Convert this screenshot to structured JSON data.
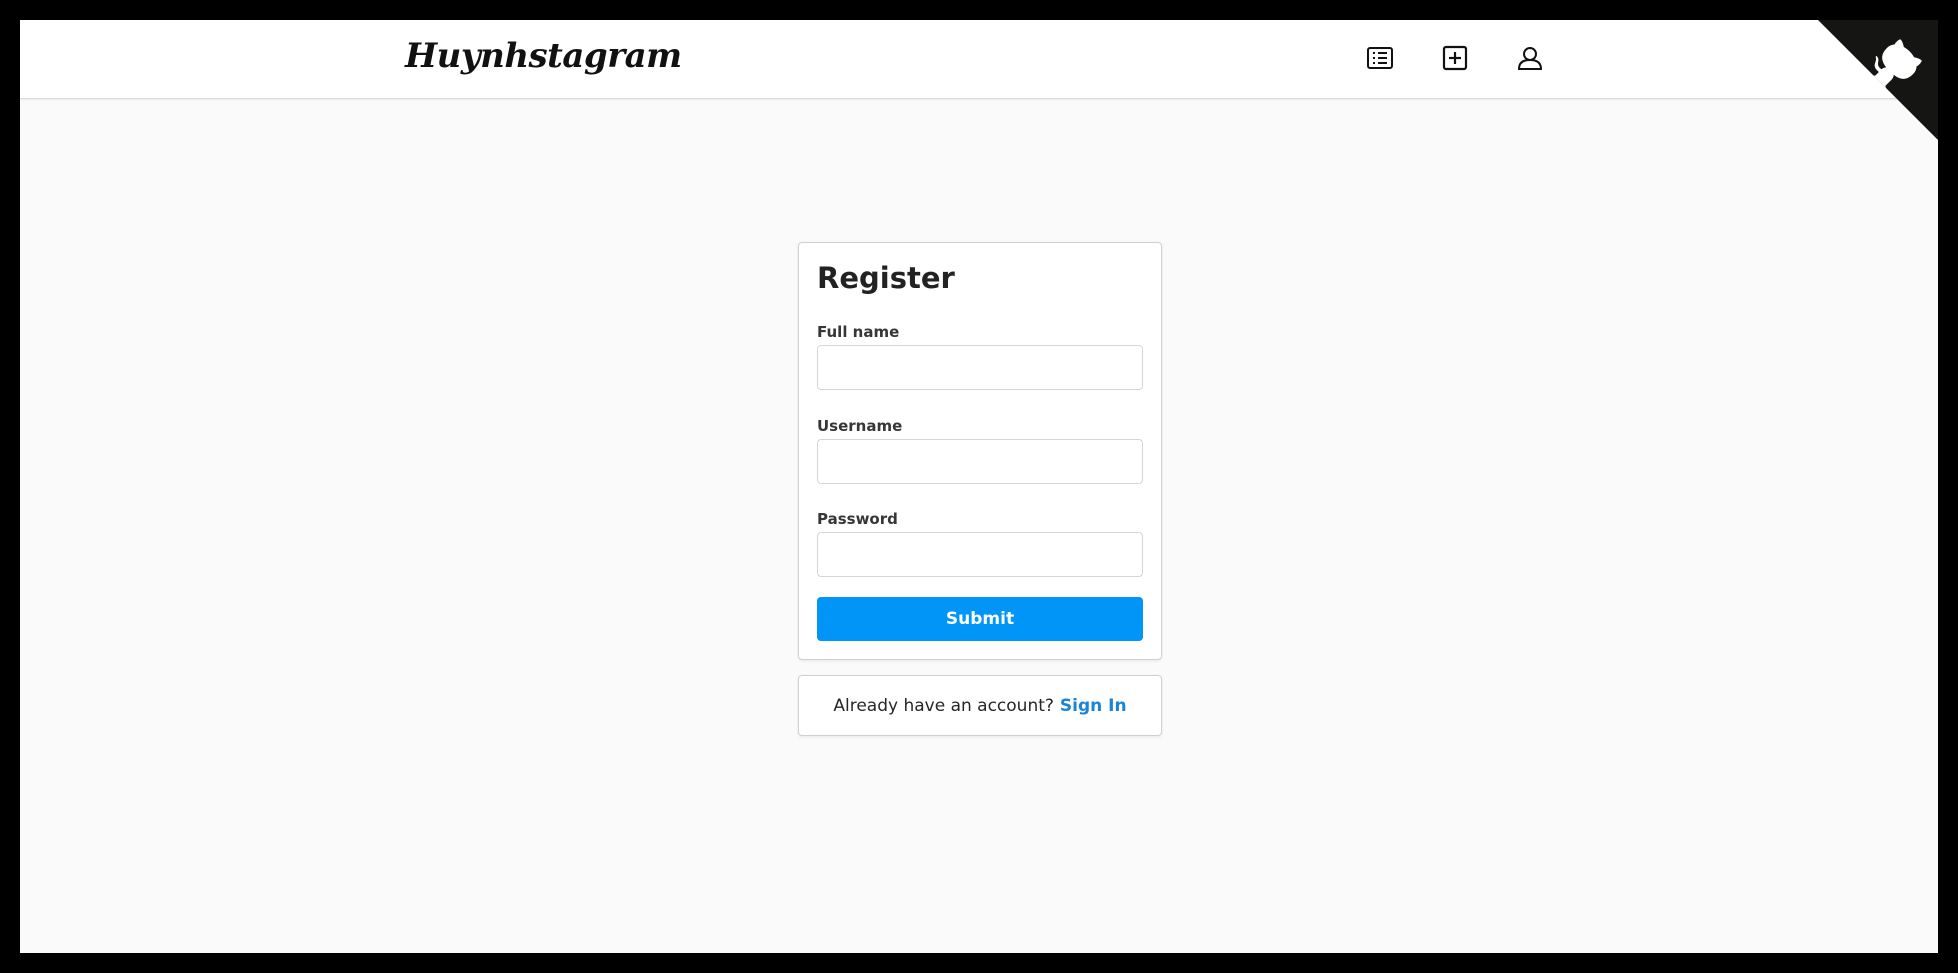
{
  "app": {
    "brand": "Huynhstagram"
  },
  "navbar": {
    "icons": [
      {
        "name": "feed-list-icon"
      },
      {
        "name": "new-post-icon"
      },
      {
        "name": "profile-icon"
      }
    ],
    "corner_icon": "github-octocat-icon"
  },
  "register": {
    "title": "Register",
    "fields": [
      {
        "label": "Full name",
        "value": "",
        "placeholder": ""
      },
      {
        "label": "Username",
        "value": "",
        "placeholder": ""
      },
      {
        "label": "Password",
        "value": "",
        "placeholder": ""
      }
    ],
    "submit_label": "Submit"
  },
  "signin": {
    "prompt": "Already have an account?",
    "link_label": "Sign In"
  },
  "colors": {
    "accent": "#0095f6",
    "link": "#1a85d6",
    "page_background": "#fafafa"
  }
}
